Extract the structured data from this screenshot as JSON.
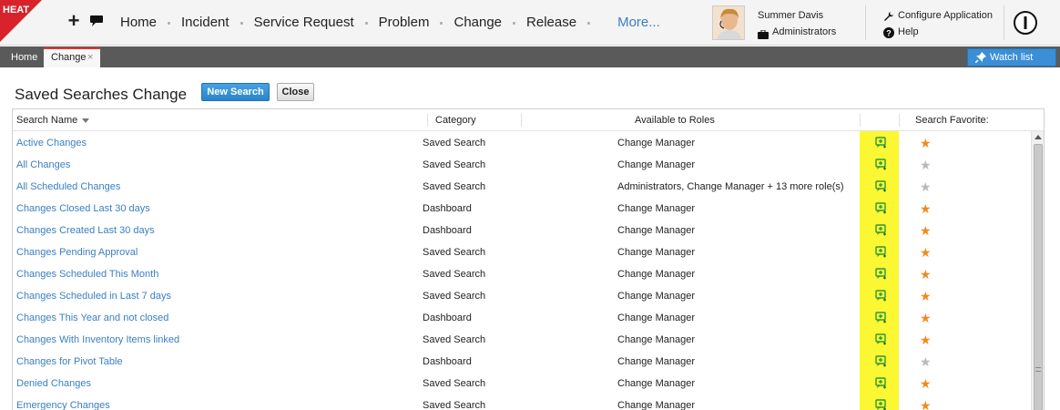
{
  "header": {
    "logo_text": "HEAT",
    "nav": [
      "Home",
      "Incident",
      "Service Request",
      "Problem",
      "Change",
      "Release"
    ],
    "more_label": "More...",
    "user_name": "Summer Davis",
    "user_role": "Administrators",
    "configure_label": "Configure Application",
    "help_label": "Help"
  },
  "tabs": {
    "home_label": "Home",
    "active_label": "Change",
    "close_symbol": "×",
    "watch_label": "Watch list"
  },
  "page": {
    "title": "Saved Searches  Change",
    "new_search_label": "New Search",
    "close_label": "Close"
  },
  "grid": {
    "columns": {
      "name": "Search Name",
      "category": "Category",
      "roles": "Available to Roles",
      "favorite": "Search Favorite:"
    },
    "rows": [
      {
        "name": "Active Changes",
        "category": "Saved Search",
        "roles": "Change Manager",
        "favorite": true
      },
      {
        "name": "All Changes",
        "category": "Saved Search",
        "roles": "Change Manager",
        "favorite": false
      },
      {
        "name": "All Scheduled Changes",
        "category": "Saved Search",
        "roles": "Administrators, Change Manager + 13 more role(s)",
        "favorite": false
      },
      {
        "name": "Changes Closed Last 30 days",
        "category": "Dashboard",
        "roles": "Change Manager",
        "favorite": true
      },
      {
        "name": "Changes Created Last 30 days",
        "category": "Dashboard",
        "roles": "Change Manager",
        "favorite": true
      },
      {
        "name": "Changes Pending Approval",
        "category": "Saved Search",
        "roles": "Change Manager",
        "favorite": true
      },
      {
        "name": "Changes Scheduled This Month",
        "category": "Saved Search",
        "roles": "Change Manager",
        "favorite": true
      },
      {
        "name": "Changes Scheduled in Last 7 days",
        "category": "Saved Search",
        "roles": "Change Manager",
        "favorite": true
      },
      {
        "name": "Changes This Year and not closed",
        "category": "Dashboard",
        "roles": "Change Manager",
        "favorite": true
      },
      {
        "name": "Changes With Inventory Items linked",
        "category": "Saved Search",
        "roles": "Change Manager",
        "favorite": true
      },
      {
        "name": "Changes for Pivot Table",
        "category": "Dashboard",
        "roles": "Change Manager",
        "favorite": false
      },
      {
        "name": "Denied Changes",
        "category": "Saved Search",
        "roles": "Change Manager",
        "favorite": true
      },
      {
        "name": "Emergency Changes",
        "category": "Saved Search",
        "roles": "Change Manager",
        "favorite": true
      }
    ]
  },
  "colors": {
    "link": "#3a7fc1",
    "highlight": "#fcf733",
    "star_on": "#f08a1c",
    "star_off": "#b9b9b9",
    "action_icon": "#2a9a3a"
  },
  "icons": {
    "plus": "plus-icon",
    "chat": "chat-icon",
    "role": "briefcase-icon",
    "configure": "wrench-icon",
    "help": "help-icon",
    "power": "power-icon",
    "pin": "pin-icon",
    "sort": "sort-down-icon",
    "row_action": "add-to-dashboard-icon",
    "favorite": "star-icon"
  }
}
